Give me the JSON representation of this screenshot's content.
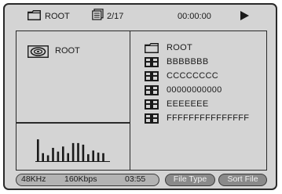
{
  "header": {
    "folder_name": "ROOT",
    "file_count": "2/17",
    "time": "00:00:00",
    "play_icon": "play-icon"
  },
  "left_panel": {
    "disc_label": "ROOT",
    "disc_icon": "disc-icon"
  },
  "spectrum": {
    "levels": [
      0.82,
      0.3,
      0.22,
      0.5,
      0.36,
      0.55,
      0.3,
      0.68,
      0.68,
      0.62,
      0.26,
      0.4,
      0.32,
      0.3
    ]
  },
  "file_list": [
    {
      "icon": "folder-icon",
      "label": "ROOT"
    },
    {
      "icon": "file-icon",
      "label": "BBBBBBB"
    },
    {
      "icon": "file-icon",
      "label": "CCCCCCCC"
    },
    {
      "icon": "file-icon",
      "label": "00000000000"
    },
    {
      "icon": "file-icon",
      "label": "EEEEEEE"
    },
    {
      "icon": "file-icon",
      "label": "FFFFFFFFFFFFFFF"
    }
  ],
  "status": {
    "frequency": "48KHz",
    "bitrate": "160Kbps",
    "duration": "03:55"
  },
  "buttons": {
    "file_type": "File Type",
    "sort_file": "Sort File"
  },
  "colors": {
    "background": "#d4d4d4",
    "border": "#2a2a2a",
    "button_fill": "#8a8a8a",
    "info_fill": "#b3b3b3"
  }
}
